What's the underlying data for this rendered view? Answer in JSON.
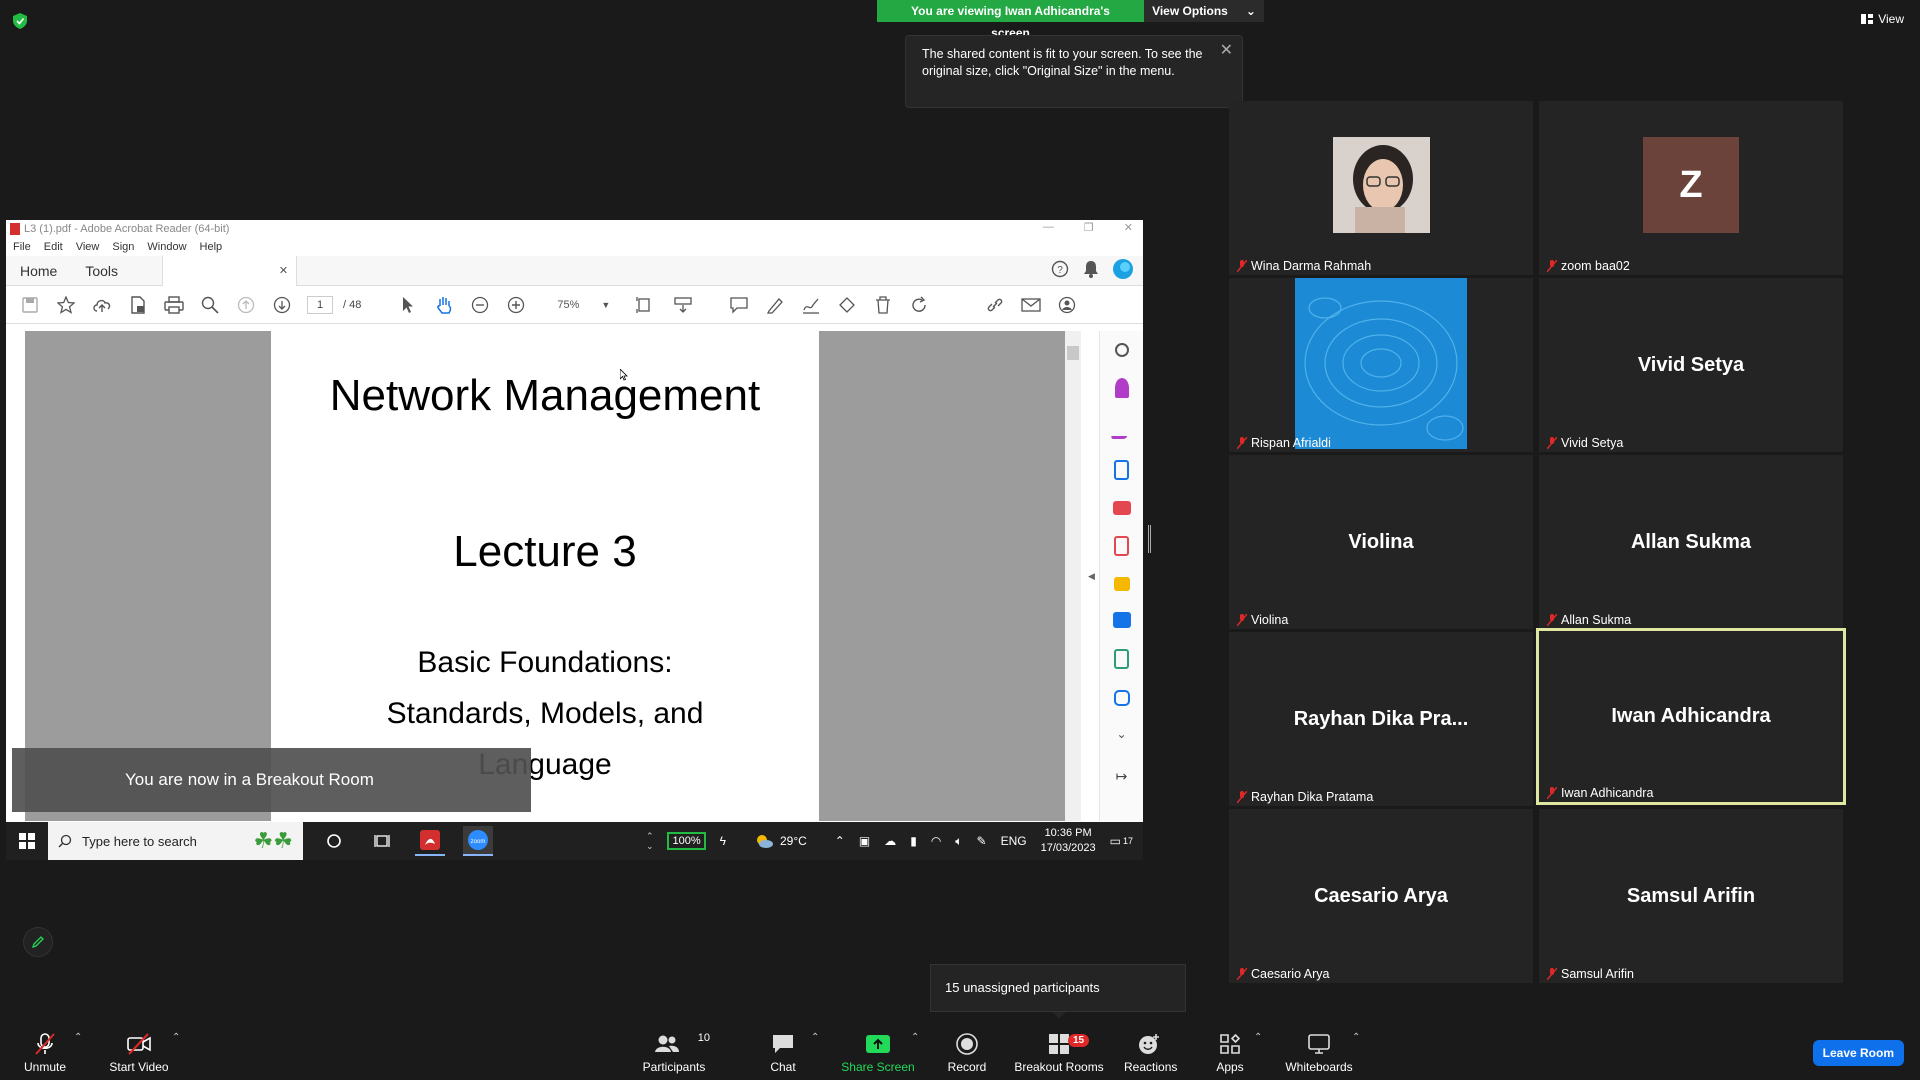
{
  "top": {
    "viewing_text": "You are viewing Iwan Adhicandra's screen",
    "view_options": "View Options",
    "tooltip": "The shared content is fit to your screen. To see the original size, click \"Original Size\" in the menu.",
    "view_label": "View"
  },
  "acrobat": {
    "title": "L3 (1).pdf - Adobe Acrobat Reader (64-bit)",
    "menu": [
      "File",
      "Edit",
      "View",
      "Sign",
      "Window",
      "Help"
    ],
    "tab_home": "Home",
    "tab_tools": "Tools",
    "file_tab": "L3 (1).pdf",
    "page_current": "1",
    "page_total": "/ 48",
    "zoom": "75%",
    "doc_title": "Network Management",
    "doc_lecture": "Lecture 3",
    "doc_sub_1": "Basic Foundations:",
    "doc_sub_2": "Standards, Models, and",
    "doc_sub_3": "Language"
  },
  "breakout_note": "You are now in a Breakout Room",
  "taskbar": {
    "search_placeholder": "Type here to search",
    "battery": "100%",
    "weather": "29°C",
    "lang": "ENG",
    "time": "10:36 PM",
    "date": "17/03/2023",
    "notif": "17"
  },
  "participants": [
    {
      "label": "Wina Darma Rahmah",
      "display": ""
    },
    {
      "label": "zoom baa02",
      "display": "Z"
    },
    {
      "label": "Rispan Afrialdi",
      "display": ""
    },
    {
      "label": "Vivid Setya",
      "display": "Vivid Setya"
    },
    {
      "label": "Violina",
      "display": "Violina"
    },
    {
      "label": "Allan Sukma",
      "display": "Allan Sukma"
    },
    {
      "label": "Rayhan Dika Pratama",
      "display": "Rayhan Dika Pra..."
    },
    {
      "label": "Iwan Adhicandra",
      "display": "Iwan Adhicandra"
    },
    {
      "label": "Caesario Arya",
      "display": "Caesario Arya"
    },
    {
      "label": "Samsul Arifin",
      "display": "Samsul Arifin"
    }
  ],
  "unassigned": "15 unassigned participants",
  "bottom": {
    "unmute": "Unmute",
    "start_video": "Start Video",
    "participants": "Participants",
    "participants_count": "10",
    "chat": "Chat",
    "share_screen": "Share Screen",
    "record": "Record",
    "breakout_rooms": "Breakout Rooms",
    "breakout_badge": "15",
    "reactions": "Reactions",
    "apps": "Apps",
    "whiteboards": "Whiteboards",
    "leave_room": "Leave Room"
  },
  "colors": {
    "banner_green": "#23a843",
    "leave_blue": "#0e71eb",
    "active_border": "#dfe7a0",
    "share_green": "#23d959"
  }
}
